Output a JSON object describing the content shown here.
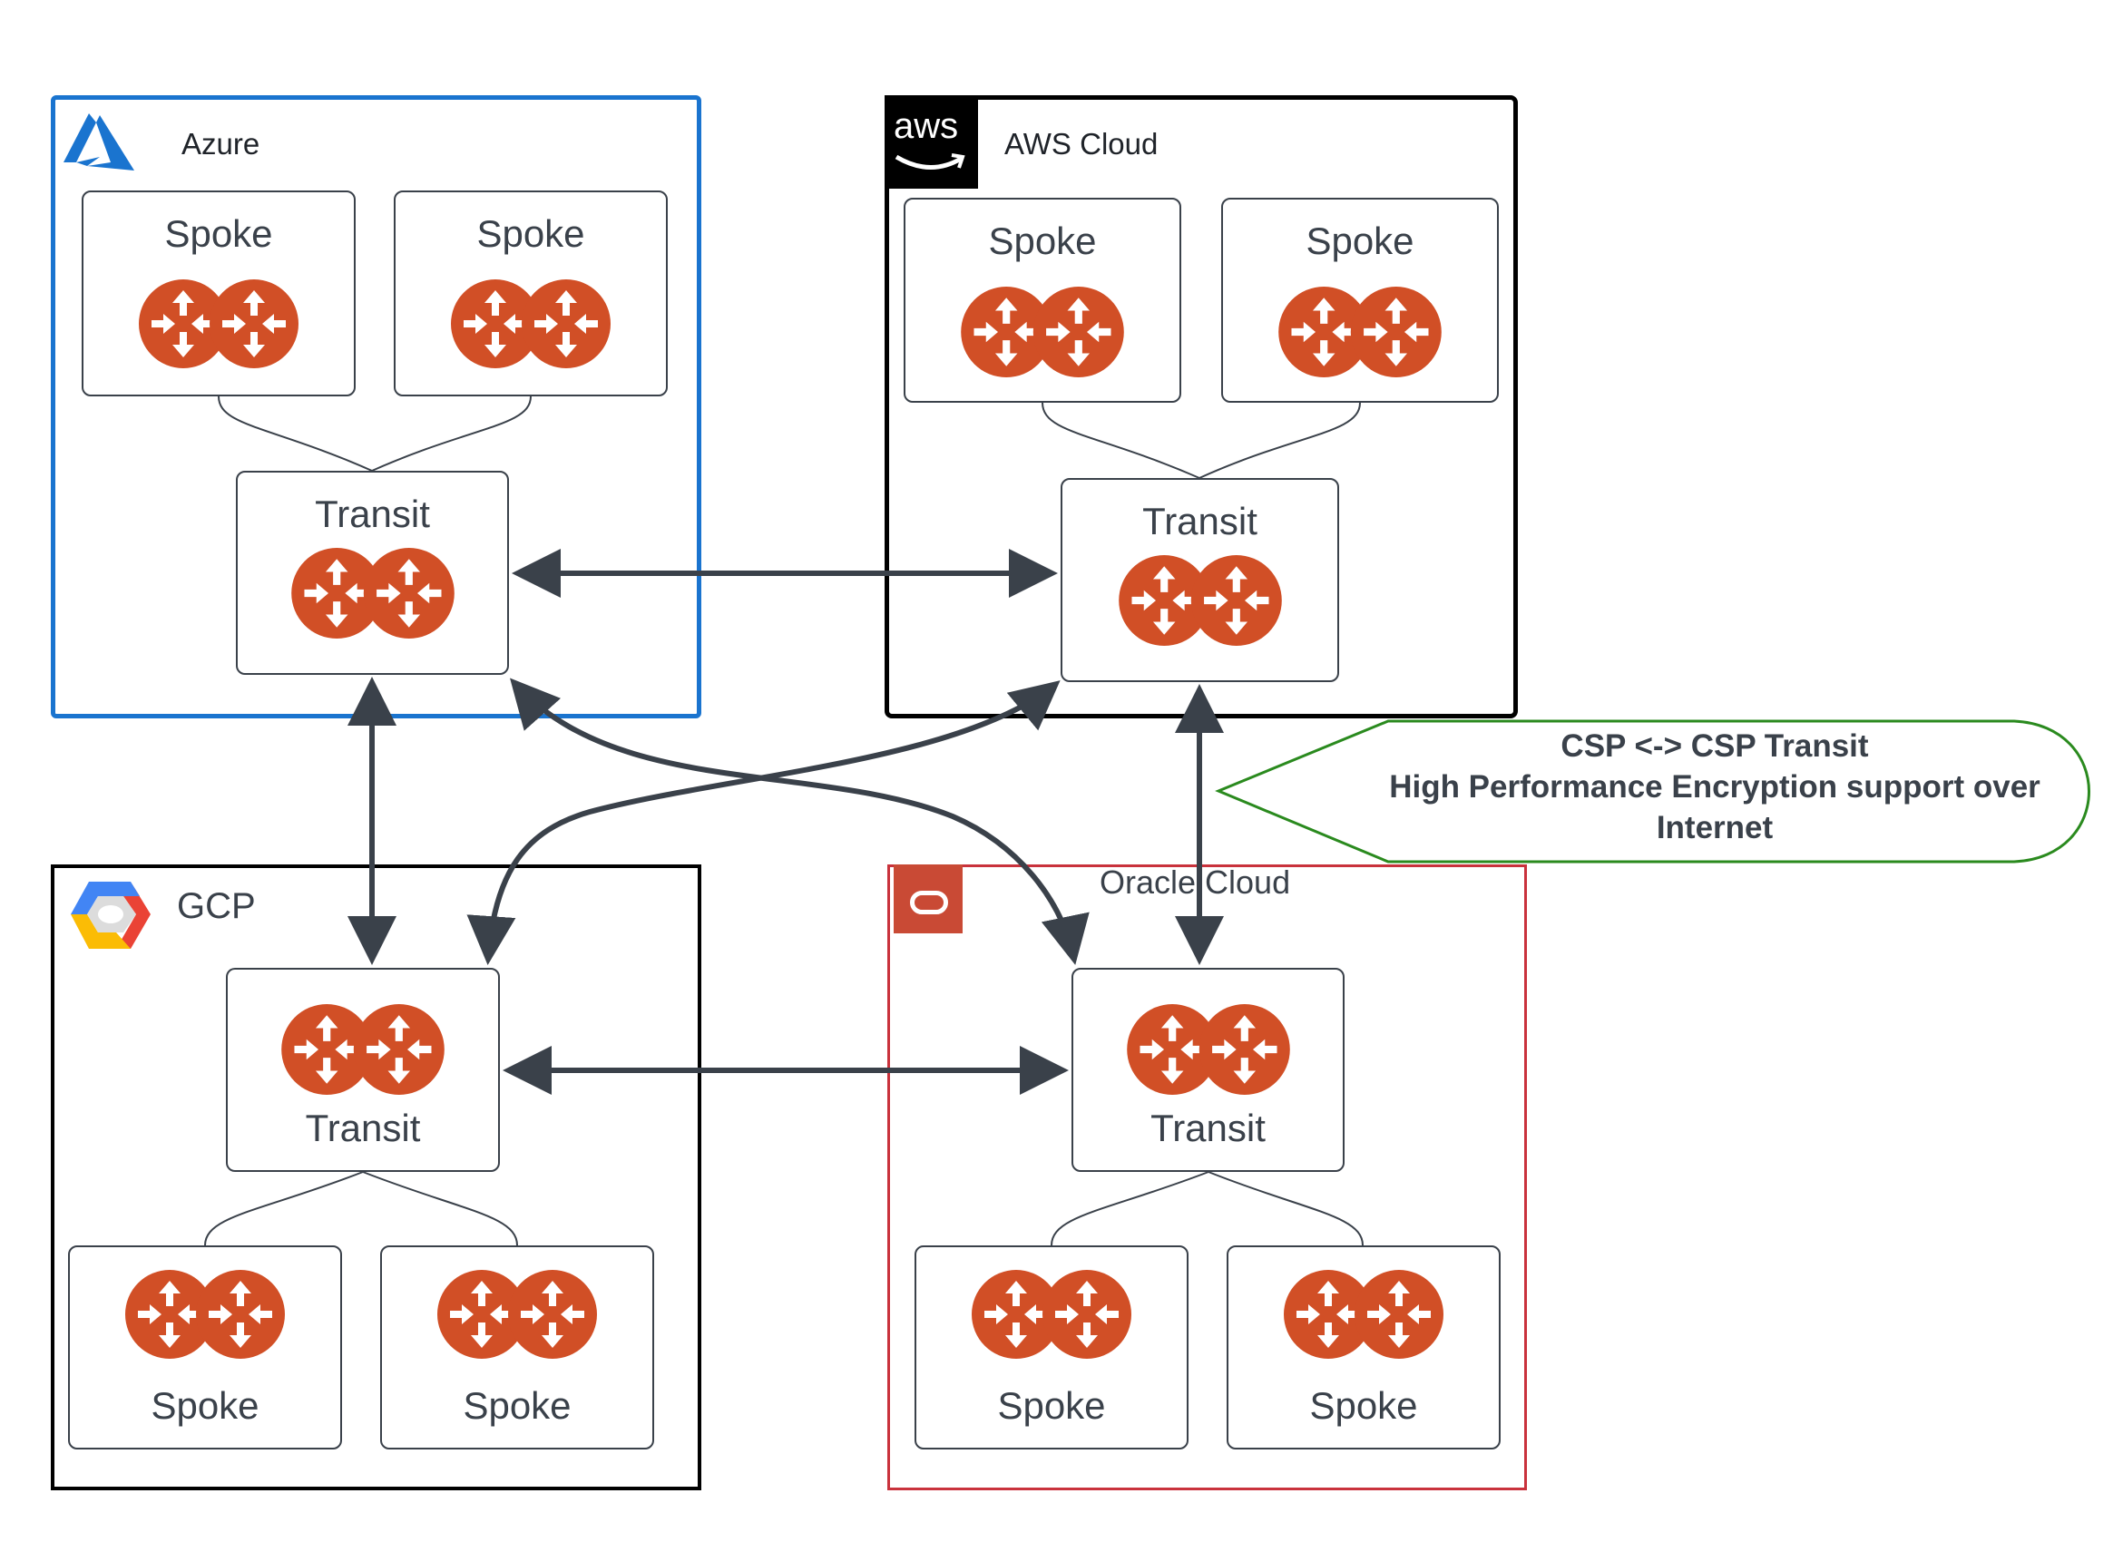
{
  "clouds": {
    "azure": {
      "title": "Azure",
      "logo": "azure-logo-icon",
      "border_color": "#1a74cf",
      "spokes": [
        {
          "label": "Spoke"
        },
        {
          "label": "Spoke"
        }
      ],
      "transit": {
        "label": "Transit"
      }
    },
    "aws": {
      "title": "AWS Cloud",
      "logo": "aws-logo-icon",
      "logo_text": "aws",
      "border_color": "#000000",
      "spokes": [
        {
          "label": "Spoke"
        },
        {
          "label": "Spoke"
        }
      ],
      "transit": {
        "label": "Transit"
      }
    },
    "gcp": {
      "title": "GCP",
      "logo": "gcp-logo-icon",
      "border_color": "#000000",
      "spokes": [
        {
          "label": "Spoke"
        },
        {
          "label": "Spoke"
        }
      ],
      "transit": {
        "label": "Transit"
      }
    },
    "oracle": {
      "title": "Oracle Cloud",
      "logo": "oracle-logo-icon",
      "border_color": "#c9323c",
      "spokes": [
        {
          "label": "Spoke"
        },
        {
          "label": "Spoke"
        }
      ],
      "transit": {
        "label": "Transit"
      }
    }
  },
  "router_icon": {
    "name": "router-icon",
    "color": "#d14f26"
  },
  "connections": [
    {
      "from": "azure.transit",
      "to": "aws.transit",
      "type": "bidirectional"
    },
    {
      "from": "azure.transit",
      "to": "gcp.transit",
      "type": "bidirectional"
    },
    {
      "from": "azure.transit",
      "to": "oracle.transit",
      "type": "bidirectional"
    },
    {
      "from": "aws.transit",
      "to": "gcp.transit",
      "type": "bidirectional"
    },
    {
      "from": "aws.transit",
      "to": "oracle.transit",
      "type": "bidirectional"
    },
    {
      "from": "gcp.transit",
      "to": "oracle.transit",
      "type": "bidirectional"
    }
  ],
  "callout": {
    "lines": [
      "CSP <-> CSP Transit",
      "High Performance Encryption support over",
      "Internet"
    ],
    "border_color": "#2a8a1e"
  },
  "colors": {
    "arrow": "#3a414a",
    "text": "#3a414a"
  }
}
